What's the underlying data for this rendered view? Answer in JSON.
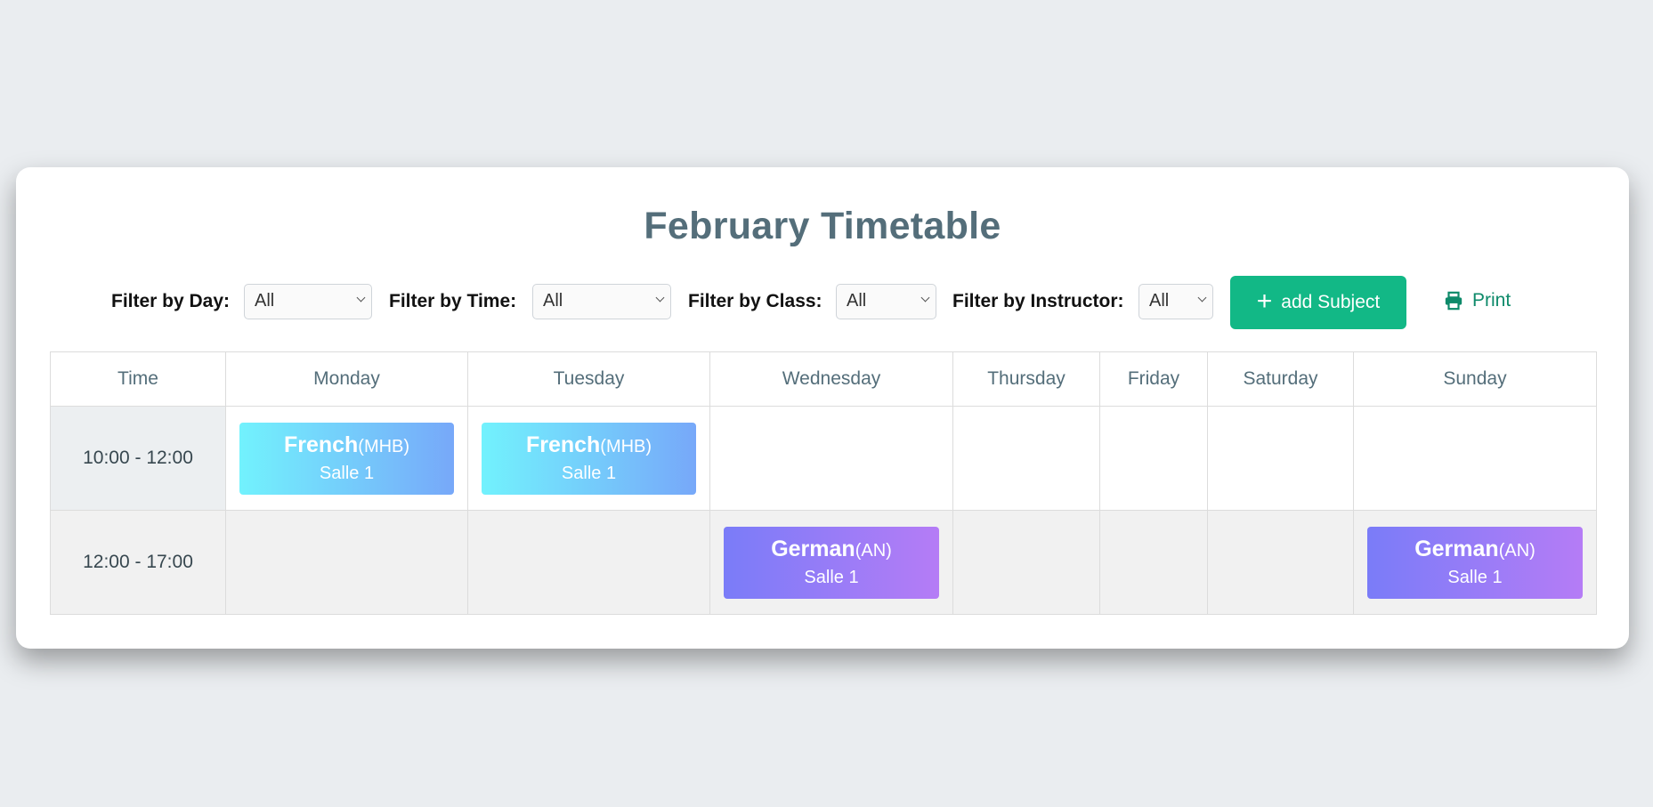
{
  "page": {
    "title": "February Timetable"
  },
  "filters": {
    "day": {
      "label": "Filter by Day:",
      "value": "All"
    },
    "time": {
      "label": "Filter by Time:",
      "value": "All"
    },
    "class": {
      "label": "Filter by Class:",
      "value": "All"
    },
    "instructor": {
      "label": "Filter by Instructor:",
      "value": "All"
    }
  },
  "actions": {
    "add_label": "add Subject",
    "add_icon": "plus-icon",
    "print_label": "Print",
    "print_icon": "printer-icon"
  },
  "colors": {
    "accent": "#12b886",
    "french_gradient": [
      "#72f2fd",
      "#77a8f9"
    ],
    "german_gradient": [
      "#7a7cf8",
      "#b57cf6"
    ]
  },
  "table": {
    "headers": [
      "Time",
      "Monday",
      "Tuesday",
      "Wednesday",
      "Thursday",
      "Friday",
      "Saturday",
      "Sunday"
    ],
    "rows": [
      {
        "time": "10:00 - 12:00",
        "cells": {
          "monday": {
            "subject": "French",
            "abbr": "(MHB)",
            "room": "Salle 1"
          },
          "tuesday": {
            "subject": "French",
            "abbr": "(MHB)",
            "room": "Salle 1"
          }
        }
      },
      {
        "time": "12:00 - 17:00",
        "cells": {
          "wednesday": {
            "subject": "German",
            "abbr": "(AN)",
            "room": "Salle 1"
          },
          "sunday": {
            "subject": "German",
            "abbr": "(AN)",
            "room": "Salle 1"
          }
        }
      }
    ]
  }
}
